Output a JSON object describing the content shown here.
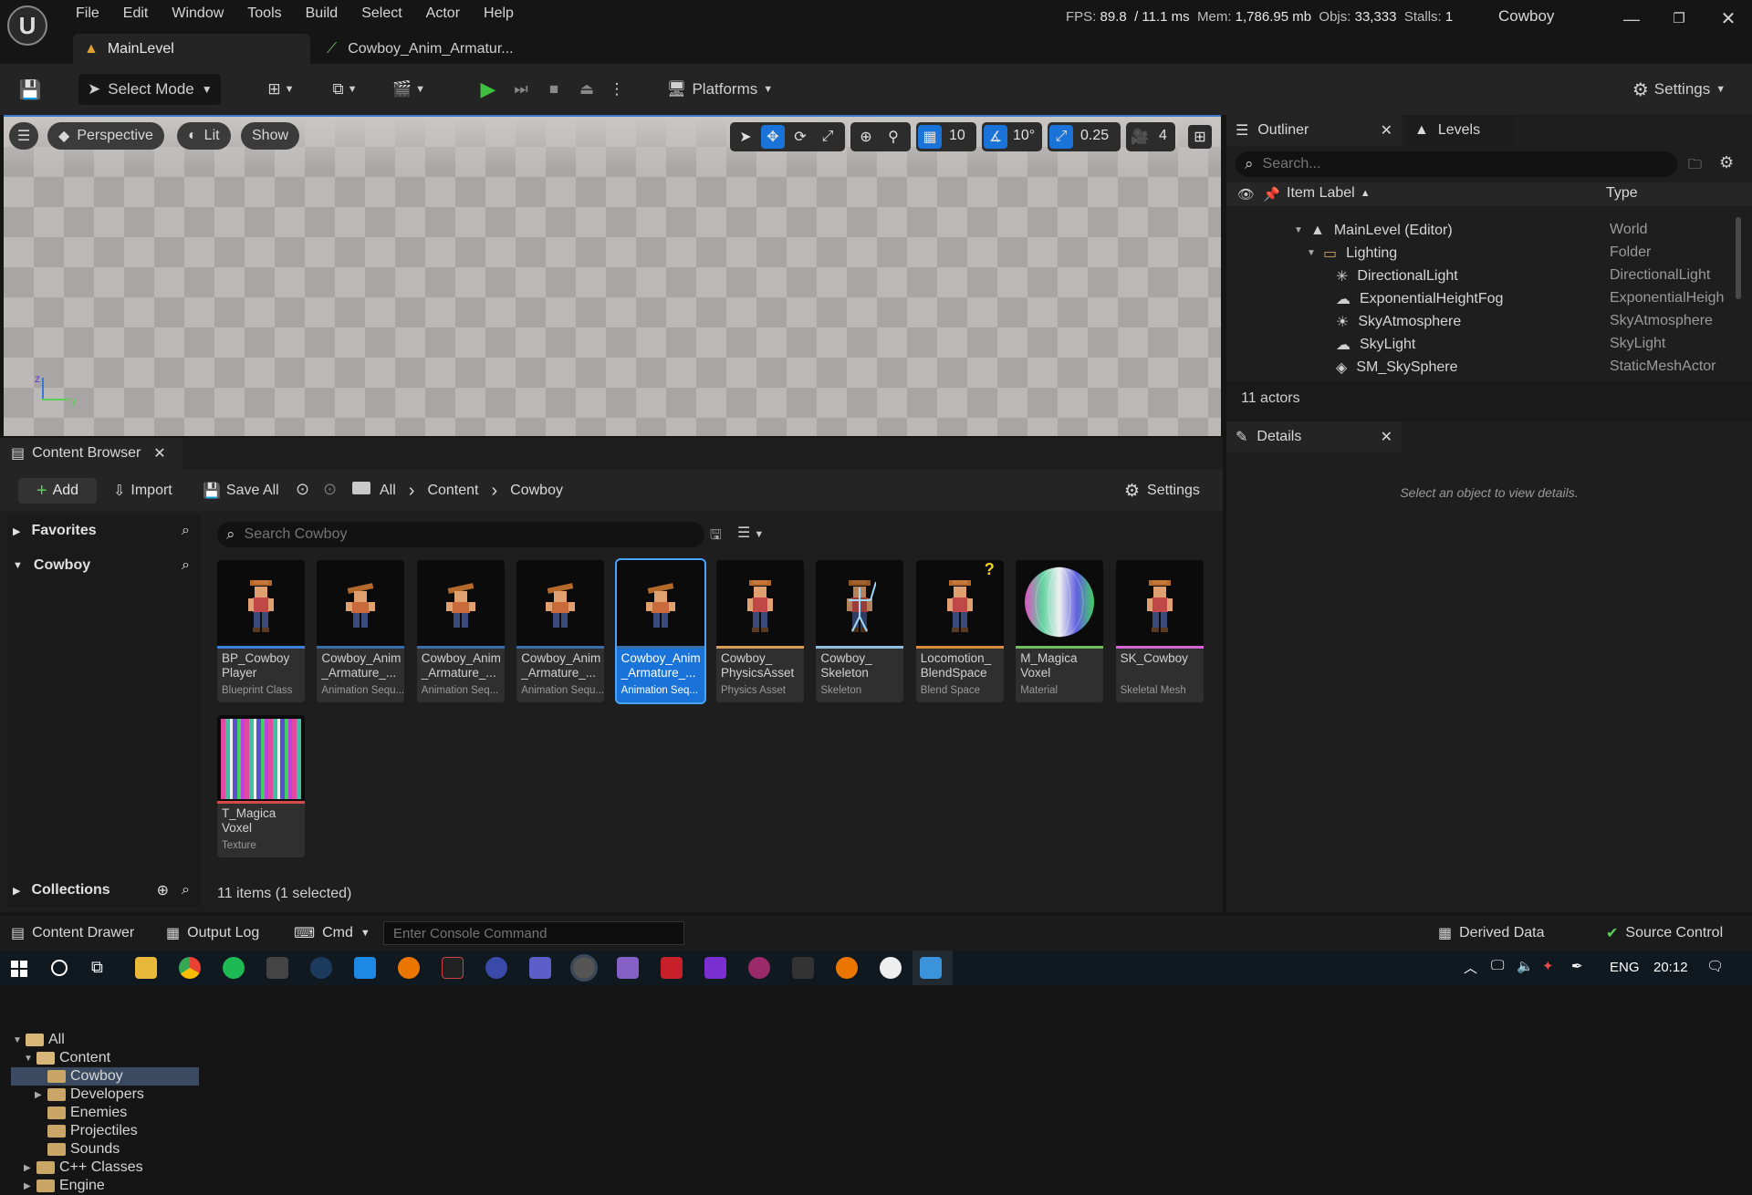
{
  "menu": [
    "File",
    "Edit",
    "Window",
    "Tools",
    "Build",
    "Select",
    "Actor",
    "Help"
  ],
  "tabs": {
    "main": "MainLevel",
    "anim": "Cowboy_Anim_Armatur..."
  },
  "stats": {
    "fps_label": "FPS:",
    "fps": "89.8",
    "ms": "/ 11.1 ms",
    "mem_label": "Mem:",
    "mem": "1,786.95 mb",
    "objs_label": "Objs:",
    "objs": "33,333",
    "stalls_label": "Stalls:",
    "stalls": "1"
  },
  "project_name": "Cowboy",
  "toolbar": {
    "select_mode": "Select Mode",
    "platforms": "Platforms",
    "settings": "Settings"
  },
  "viewport": {
    "perspective": "Perspective",
    "lit": "Lit",
    "show": "Show",
    "grid": "10",
    "rotation": "10°",
    "scale": "0.25",
    "camera": "4",
    "axis_z": "z",
    "axis_y": "y"
  },
  "content_browser": {
    "title": "Content Browser",
    "add": "Add",
    "import": "Import",
    "save_all": "Save All",
    "settings": "Settings",
    "breadcrumb": [
      "All",
      "Content",
      "Cowboy"
    ],
    "favorites": "Favorites",
    "section": "Cowboy",
    "search_placeholder": "Search Cowboy",
    "tree": [
      {
        "label": "All",
        "depth": 0,
        "expand": "▼",
        "open": true
      },
      {
        "label": "Content",
        "depth": 1,
        "expand": "▼",
        "open": true
      },
      {
        "label": "Cowboy",
        "depth": 2,
        "expand": "",
        "selected": true
      },
      {
        "label": "Developers",
        "depth": 2,
        "expand": "▶"
      },
      {
        "label": "Enemies",
        "depth": 2,
        "expand": ""
      },
      {
        "label": "Projectiles",
        "depth": 2,
        "expand": ""
      },
      {
        "label": "Sounds",
        "depth": 2,
        "expand": ""
      },
      {
        "label": "C++ Classes",
        "depth": 1,
        "expand": "▶"
      },
      {
        "label": "Engine",
        "depth": 1,
        "expand": "▶"
      }
    ],
    "assets": [
      {
        "name": "BP_Cowboy\nPlayer",
        "type": "Blueprint Class",
        "stripe": "#3c7fd8",
        "thumb": "char"
      },
      {
        "name": "Cowboy_Anim\n_Armature_...",
        "type": "Animation Sequ...",
        "stripe": "#3a6ea8",
        "thumb": "anim"
      },
      {
        "name": "Cowboy_Anim\n_Armature_...",
        "type": "Animation Seq...",
        "stripe": "#3a6ea8",
        "thumb": "anim"
      },
      {
        "name": "Cowboy_Anim\n_Armature_...",
        "type": "Animation Sequ...",
        "stripe": "#3a6ea8",
        "thumb": "anim"
      },
      {
        "name": "Cowboy_Anim\n_Armature_...",
        "type": "Animation Seq...",
        "stripe": "#3a6ea8",
        "thumb": "anim",
        "selected": true
      },
      {
        "name": "Cowboy_\nPhysicsAsset",
        "type": "Physics Asset",
        "stripe": "#d99a5a",
        "thumb": "char"
      },
      {
        "name": "Cowboy_\nSkeleton",
        "type": "Skeleton",
        "stripe": "#8fbfe0",
        "thumb": "skeleton"
      },
      {
        "name": "Locomotion_\nBlendSpace",
        "type": "Blend Space",
        "stripe": "#d98a3a",
        "thumb": "blend"
      },
      {
        "name": "M_Magica\nVoxel",
        "type": "Material",
        "stripe": "#6ebf5a",
        "thumb": "sphere"
      },
      {
        "name": "SK_Cowboy",
        "type": "Skeletal Mesh",
        "stripe": "#d466d4",
        "thumb": "char"
      },
      {
        "name": "T_Magica\nVoxel",
        "type": "Texture",
        "stripe": "#d44a4a",
        "thumb": "texture"
      }
    ],
    "item_count": "11 items (1 selected)",
    "collections": "Collections"
  },
  "outliner": {
    "title": "Outliner",
    "levels_tab": "Levels",
    "search_placeholder": "Search...",
    "col_label": "Item Label",
    "col_type": "Type",
    "rows": [
      {
        "label": "MainLevel (Editor)",
        "type": "World",
        "indent": 0
      },
      {
        "label": "Lighting",
        "type": "Folder",
        "indent": 1
      },
      {
        "label": "DirectionalLight",
        "type": "DirectionalLight",
        "indent": 2
      },
      {
        "label": "ExponentialHeightFog",
        "type": "ExponentialHeigh",
        "indent": 2
      },
      {
        "label": "SkyAtmosphere",
        "type": "SkyAtmosphere",
        "indent": 2
      },
      {
        "label": "SkyLight",
        "type": "SkyLight",
        "indent": 2
      },
      {
        "label": "SM_SkySphere",
        "type": "StaticMeshActor",
        "indent": 2
      }
    ],
    "count": "11 actors"
  },
  "details": {
    "title": "Details",
    "empty": "Select an object to view details."
  },
  "statusbar": {
    "content_drawer": "Content Drawer",
    "output_log": "Output Log",
    "cmd": "Cmd",
    "console_placeholder": "Enter Console Command",
    "derived_data": "Derived Data",
    "source_control": "Source Control"
  },
  "taskbar": {
    "lang": "ENG",
    "time": "20:12"
  },
  "colors": {
    "accent": "#1a73d8",
    "play": "#3fbf3f",
    "folder": "#c9a566"
  }
}
